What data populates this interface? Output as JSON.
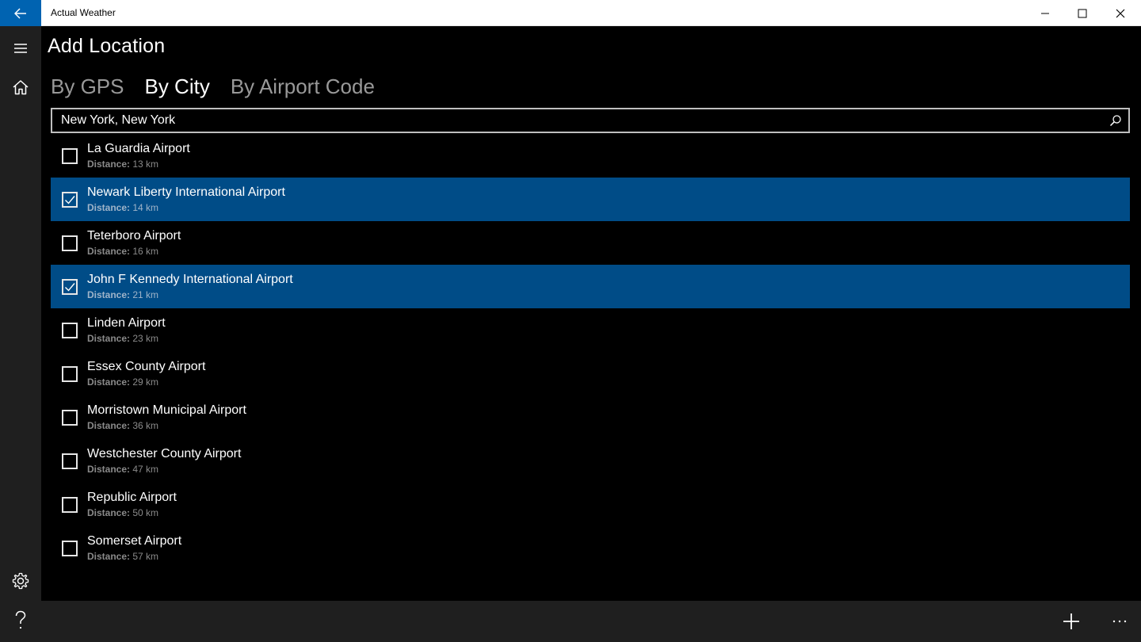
{
  "app": {
    "title": "Actual Weather"
  },
  "page": {
    "title": "Add Location"
  },
  "tabs": [
    {
      "label": "By GPS",
      "active": false
    },
    {
      "label": "By City",
      "active": true
    },
    {
      "label": "By Airport Code",
      "active": false
    }
  ],
  "search": {
    "value": "New York, New York"
  },
  "distance_label": "Distance:",
  "airports": [
    {
      "name": "La Guardia Airport",
      "distance": "13 km",
      "checked": false
    },
    {
      "name": "Newark Liberty International Airport",
      "distance": "14 km",
      "checked": true
    },
    {
      "name": "Teterboro Airport",
      "distance": "16 km",
      "checked": false
    },
    {
      "name": "John F Kennedy International Airport",
      "distance": "21 km",
      "checked": true
    },
    {
      "name": "Linden Airport",
      "distance": "23 km",
      "checked": false
    },
    {
      "name": "Essex County Airport",
      "distance": "29 km",
      "checked": false
    },
    {
      "name": "Morristown Municipal Airport",
      "distance": "36 km",
      "checked": false
    },
    {
      "name": "Westchester County Airport",
      "distance": "47 km",
      "checked": false
    },
    {
      "name": "Republic Airport",
      "distance": "50 km",
      "checked": false
    },
    {
      "name": "Somerset Airport",
      "distance": "57 km",
      "checked": false
    }
  ],
  "icons": {
    "back": "back-arrow-icon",
    "menu": "hamburger-icon",
    "home": "home-icon",
    "settings": "gear-icon",
    "help": "question-icon",
    "add": "plus-icon",
    "more": "ellipsis-icon"
  },
  "colors": {
    "accent": "#0063b1",
    "selection": "#004c87"
  }
}
